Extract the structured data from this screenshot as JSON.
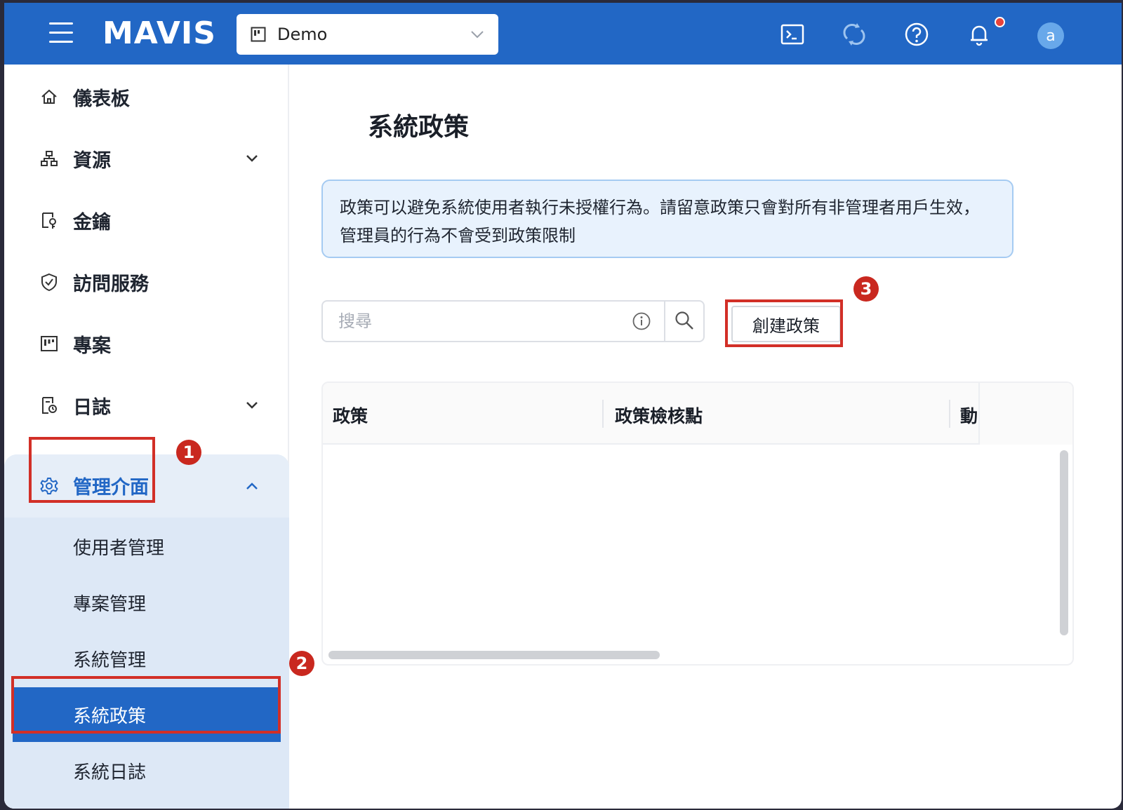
{
  "header": {
    "logo_text": "MAVIS",
    "project_select": "Demo",
    "icons": [
      "menu-icon",
      "terminal-icon",
      "sync-icon",
      "help-icon",
      "bell-icon"
    ],
    "avatar_letter": "a"
  },
  "sidebar": {
    "items": [
      {
        "label": "儀表板",
        "icon": "home-icon"
      },
      {
        "label": "資源",
        "icon": "resources-icon",
        "expandable": true
      },
      {
        "label": "金鑰",
        "icon": "key-icon"
      },
      {
        "label": "訪問服務",
        "icon": "shield-icon"
      },
      {
        "label": "專案",
        "icon": "project-icon"
      },
      {
        "label": "日誌",
        "icon": "log-icon",
        "expandable": true
      }
    ],
    "admin": {
      "label": "管理介面",
      "icon": "gear-icon",
      "expanded": true,
      "children": [
        {
          "label": "使用者管理"
        },
        {
          "label": "專案管理"
        },
        {
          "label": "系統管理"
        },
        {
          "label": "系統政策",
          "active": true
        },
        {
          "label": "系統日誌"
        }
      ]
    }
  },
  "main": {
    "title": "系統政策",
    "info_text": "政策可以避免系統使用者執行未授權行為。請留意政策只會對所有非管理者用戶生效，管理員的行為不會受到政策限制",
    "search_placeholder": "搜尋",
    "create_button": "創建政策",
    "table": {
      "columns": [
        "政策",
        "政策檢核點",
        "動"
      ],
      "rows": []
    }
  },
  "annotations": [
    "1",
    "2",
    "3"
  ],
  "colors": {
    "primary": "#2267c5",
    "annotation": "#d22f27",
    "info_bg": "#e8f2fd"
  }
}
